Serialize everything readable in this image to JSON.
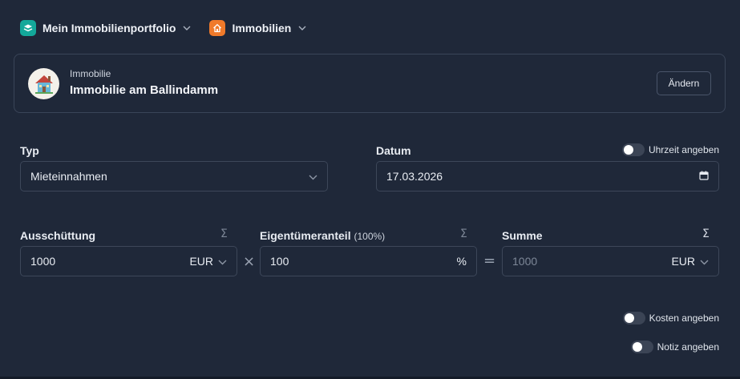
{
  "nav": {
    "portfolio_label": "Mein Immobilienportfolio",
    "section_label": "Immobilien"
  },
  "property": {
    "subtitle": "Immobilie",
    "name": "Immobilie am Ballindamm",
    "change_label": "Ändern"
  },
  "form": {
    "type": {
      "label": "Typ",
      "value": "Mieteinnahmen"
    },
    "date": {
      "label": "Datum",
      "value": "17.03.2026",
      "time_toggle_label": "Uhrzeit angeben",
      "time_toggle_on": false
    },
    "distribution": {
      "label": "Ausschüttung",
      "value": "1000",
      "currency": "EUR",
      "sigma": "Σ"
    },
    "ownership": {
      "label": "Eigentümeranteil",
      "hint": "(100%)",
      "value": "100",
      "unit": "%",
      "sigma": "Σ"
    },
    "sum": {
      "label": "Summe",
      "value": "1000",
      "currency": "EUR",
      "sigma": "Σ"
    },
    "operators": {
      "multiply": "×",
      "equals": "="
    },
    "costs_toggle_label": "Kosten angeben",
    "note_toggle_label": "Notiz angeben"
  },
  "colors": {
    "background": "#1f2839",
    "border": "#3d4759",
    "portfolio_icon": "#13a89a",
    "section_icon": "#f07a2a"
  },
  "icons": {
    "portfolio": "layers-icon",
    "section": "house-icon",
    "dropdown": "chevron-down-icon",
    "calendar": "calendar-icon",
    "avatar": "house-illustration"
  }
}
